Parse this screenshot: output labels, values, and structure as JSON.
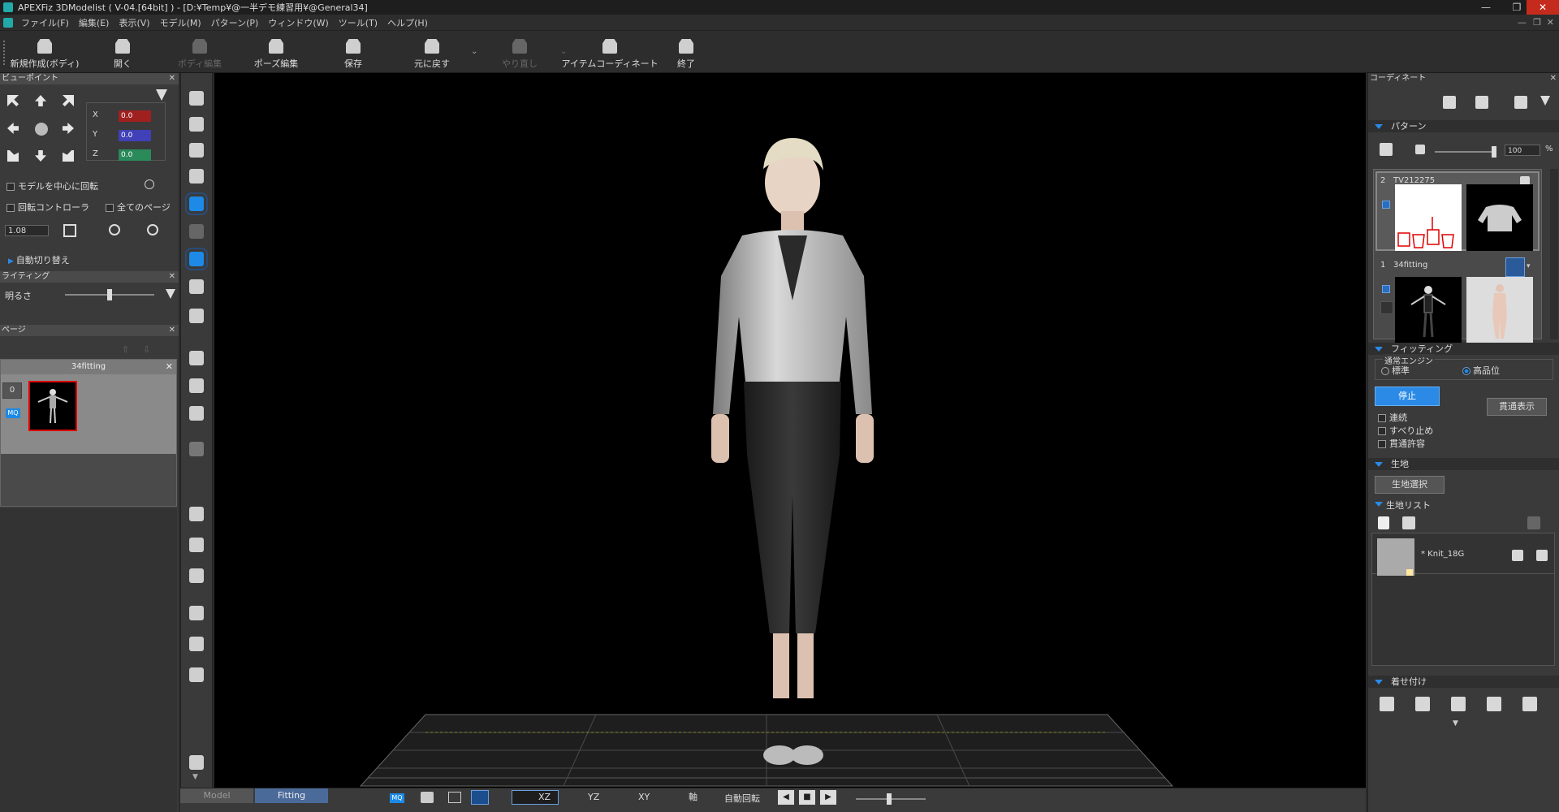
{
  "window": {
    "title": "APEXFiz 3DModelist ( V-04.[64bit] ) - [D:¥Temp¥@一半デモ練習用¥@General34]",
    "min": "—",
    "max": "❐",
    "close": "✕"
  },
  "menu": [
    "ファイル(F)",
    "編集(E)",
    "表示(V)",
    "モデル(M)",
    "パターン(P)",
    "ウィンドウ(W)",
    "ツール(T)",
    "ヘルプ(H)"
  ],
  "toolbar": [
    {
      "label": "新規作成(ボディ)",
      "enabled": true
    },
    {
      "label": "開く",
      "enabled": true
    },
    {
      "label": "ボディ編集",
      "enabled": false
    },
    {
      "label": "ポーズ編集",
      "enabled": true
    },
    {
      "label": "保存",
      "enabled": true
    },
    {
      "label": "元に戻す",
      "enabled": true
    },
    {
      "label": "やり直し",
      "enabled": false
    },
    {
      "label": "アイテムコーディネート",
      "enabled": true
    },
    {
      "label": "終了",
      "enabled": true
    }
  ],
  "viewpoint": {
    "title": "ビューポイント",
    "x": "0.0",
    "y": "0.0",
    "z": "0.0",
    "x_label": "X",
    "y_label": "Y",
    "z_label": "Z",
    "rotate_center": "モデルを中心に回転",
    "rotate_ctrl": "回転コントローラ",
    "all_pages": "全てのページ",
    "zoom": "1.08",
    "auto_switch": "自動切り替え"
  },
  "lighting": {
    "title": "ライティング",
    "brightness_label": "明るさ",
    "brightness": 0.5
  },
  "page": {
    "title": "ページ",
    "tab_name": "34fitting",
    "index": "0",
    "badge": "MQ"
  },
  "vtools_selected": [
    3,
    5
  ],
  "bottom": {
    "tabs": [
      "Model",
      "Fitting"
    ],
    "active_tab": "Fitting",
    "mq": "MQ",
    "axes": [
      "XZ",
      "YZ",
      "XY",
      "軸"
    ],
    "auto_rotate": "自動回転"
  },
  "coordinate": {
    "title": "コーディネート",
    "pattern_section": "パターン",
    "opacity": "100",
    "opacity_unit": "%",
    "items": [
      {
        "num": "2",
        "name": "TV212275"
      },
      {
        "num": "1",
        "name": "34fitting"
      }
    ],
    "fitting_section": "フィッティング",
    "engine_label": "通常エンジン",
    "standard": "標準",
    "high_quality": "高品位",
    "stop": "停止",
    "through_display": "貫通表示",
    "continuous": "連続",
    "no_slip": "すべり止め",
    "allow_penetration": "貫通許容",
    "fabric_section": "生地",
    "fabric_select": "生地選択",
    "fabric_list": "生地リスト",
    "fabric_name": "* Knit_18G",
    "dress_section": "着せ付け"
  }
}
